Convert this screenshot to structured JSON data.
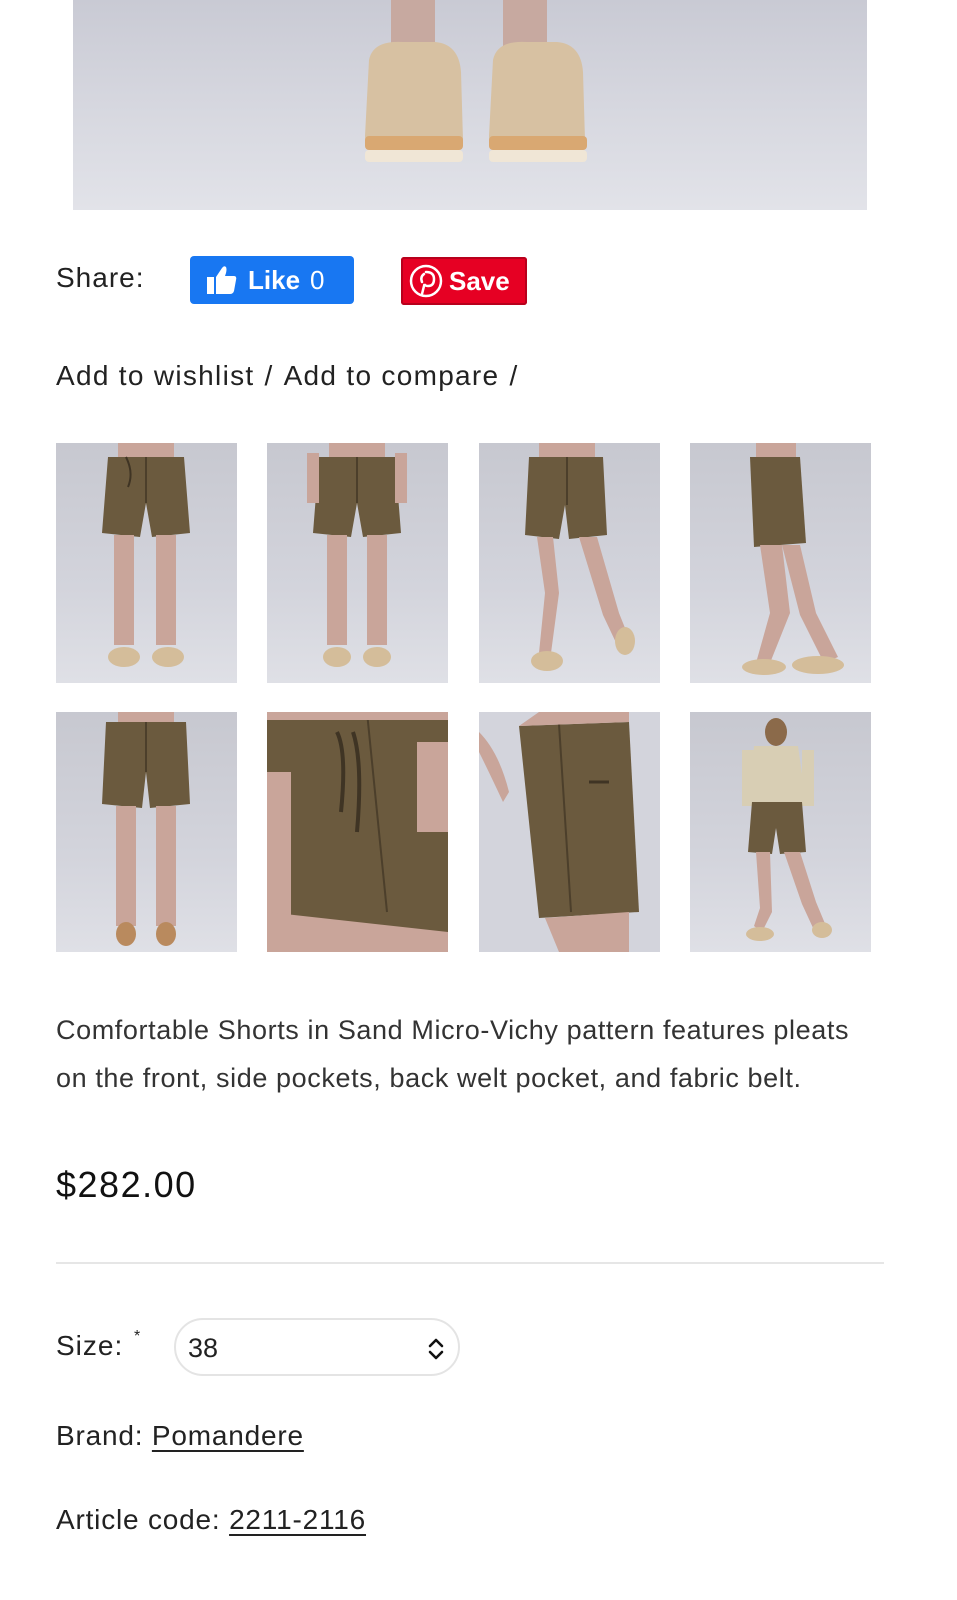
{
  "hero": {
    "alt": "Model feet wearing suede mule clogs"
  },
  "share": {
    "label": "Share:",
    "facebook": {
      "label": "Like",
      "count": "0",
      "color": "#1877f2"
    },
    "pinterest": {
      "label": "Save",
      "color": "#e60023"
    }
  },
  "actions": {
    "wishlist": "Add to wishlist",
    "compare": "Add to compare",
    "separator": "/"
  },
  "thumbnails": [
    {
      "view": "front"
    },
    {
      "view": "front-hands-in-pockets"
    },
    {
      "view": "front-walking"
    },
    {
      "view": "side"
    },
    {
      "view": "back"
    },
    {
      "view": "detail-front-belt"
    },
    {
      "view": "detail-side-pocket"
    },
    {
      "view": "full-outfit-cardigan"
    }
  ],
  "product": {
    "description": "Comfortable Shorts in Sand Micro-Vichy pattern features pleats on the front, side pockets, back welt pocket, and fabric belt.",
    "price": "$282.00"
  },
  "size": {
    "label": "Size:",
    "required_mark": "*",
    "selected": "38"
  },
  "brand": {
    "label": "Brand:",
    "value": "Pomandere"
  },
  "article": {
    "label": "Article code:",
    "value": "2211-2116"
  },
  "colors": {
    "shorts": "#6b5a3e",
    "background": "#d3d4dc",
    "divider": "#e6e6e6"
  }
}
